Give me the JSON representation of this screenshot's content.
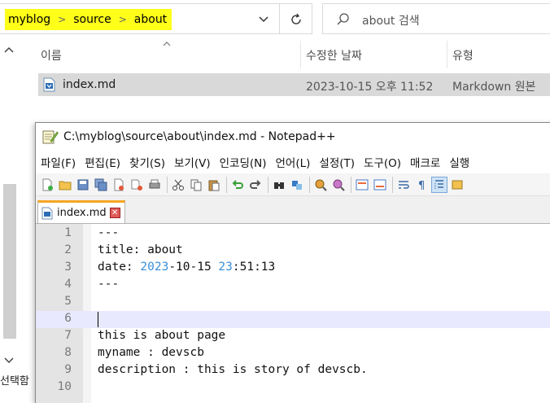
{
  "explorer": {
    "breadcrumbs": [
      "myblog",
      "source",
      "about"
    ],
    "search_placeholder": "about 검색",
    "columns": [
      "이름",
      "수정한 날짜",
      "유형"
    ],
    "file": {
      "name": "index.md",
      "modified": "2023-10-15 오후 11:52",
      "type": "Markdown 원본"
    },
    "nav_label": "선택함",
    "highlight_color": "#ffff1a"
  },
  "notepad": {
    "title": "C:\\myblog\\source\\about\\index.md - Notepad++",
    "menu": [
      "파일(F)",
      "편집(E)",
      "찾기(S)",
      "보기(V)",
      "인코딩(N)",
      "언어(L)",
      "설정(T)",
      "도구(O)",
      "매크로",
      "실행"
    ],
    "tab_label": "index.md",
    "tab_accent_color": "#f5a623",
    "lines": [
      {
        "n": "1",
        "text": "---"
      },
      {
        "n": "2",
        "text": "title: about"
      },
      {
        "n": "3",
        "text": "date: 2023-10-15 23:51:13"
      },
      {
        "n": "4",
        "text": "---"
      },
      {
        "n": "5",
        "text": ""
      },
      {
        "n": "6",
        "text": ""
      },
      {
        "n": "7",
        "text": "this is about page"
      },
      {
        "n": "8",
        "text": "myname : devscb"
      },
      {
        "n": "9",
        "text": "description : this is story of devscb."
      },
      {
        "n": "10",
        "text": ""
      }
    ],
    "current_line": 6
  }
}
